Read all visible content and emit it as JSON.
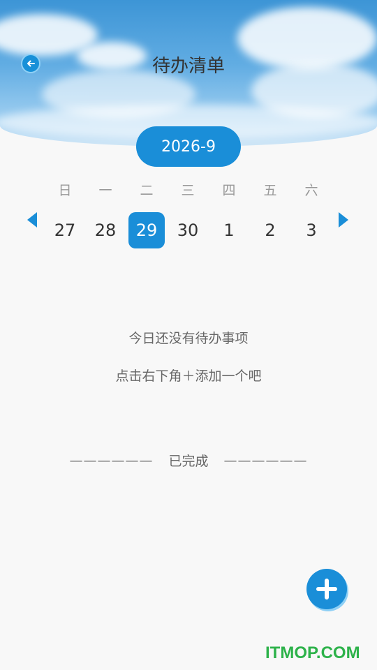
{
  "header": {
    "title": "待办清单"
  },
  "calendar": {
    "month_label": "2026-9",
    "weekdays": [
      "日",
      "一",
      "二",
      "三",
      "四",
      "五",
      "六"
    ],
    "days": [
      "27",
      "28",
      "29",
      "30",
      "1",
      "2",
      "3"
    ],
    "selected_day": "29"
  },
  "empty_state": {
    "line1": "今日还没有待办事项",
    "line2": "点击右下角＋添加一个吧"
  },
  "completed": {
    "dash_left": "——————",
    "label": "已完成",
    "dash_right": "——————"
  },
  "watermark": "ITMOP.COM",
  "colors": {
    "accent": "#1a8ed8",
    "text": "#333333",
    "muted": "#999999",
    "watermark": "#2db24a"
  },
  "icons": {
    "back": "arrow-left-circle-icon",
    "prev": "triangle-left-icon",
    "next": "triangle-right-icon",
    "add": "plus-icon"
  }
}
